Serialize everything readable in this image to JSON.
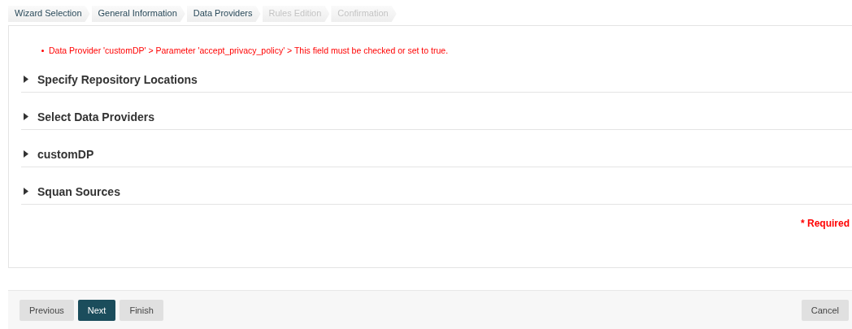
{
  "steps": [
    {
      "label": "Wizard Selection",
      "disabled": false
    },
    {
      "label": "General Information",
      "disabled": false
    },
    {
      "label": "Data Providers",
      "disabled": false
    },
    {
      "label": "Rules Edition",
      "disabled": true
    },
    {
      "label": "Confirmation",
      "disabled": true
    }
  ],
  "errors": [
    "Data Provider 'customDP' > Parameter 'accept_privacy_policy' > This field must be checked or set to true."
  ],
  "sections": [
    {
      "title": "Specify Repository Locations",
      "expanded": false
    },
    {
      "title": "Select Data Providers",
      "expanded": false
    },
    {
      "title": "customDP",
      "expanded": false
    },
    {
      "title": "Squan Sources",
      "expanded": false
    }
  ],
  "required_note": "* Required",
  "buttons": [
    {
      "label": "Previous",
      "kind": "secondary"
    },
    {
      "label": "Next",
      "kind": "primary"
    },
    {
      "label": "Finish",
      "kind": "secondary"
    }
  ],
  "cancel_button": "Cancel"
}
